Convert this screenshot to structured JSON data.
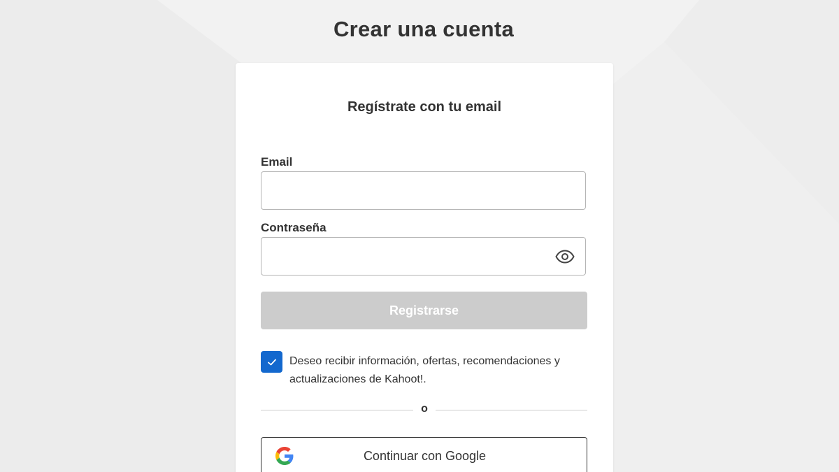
{
  "page": {
    "title": "Crear una cuenta"
  },
  "card": {
    "subtitle": "Regístrate con tu email"
  },
  "email_field": {
    "label": "Email",
    "value": "",
    "placeholder": ""
  },
  "password_field": {
    "label": "Contraseña",
    "value": "",
    "placeholder": "",
    "toggle_icon": "eye-icon"
  },
  "submit": {
    "label": "Registrarse",
    "state": "disabled"
  },
  "consent": {
    "checked": true,
    "text": "Deseo recibir información, ofertas, recomendaciones y actualizaciones de Kahoot!."
  },
  "divider": {
    "text": "o"
  },
  "google_button": {
    "label": "Continuar con Google",
    "icon": "google-icon"
  },
  "colors": {
    "background": "#ececec",
    "card": "#ffffff",
    "text": "#333333",
    "checkbox_accent": "#1368ce",
    "disabled_button": "#cccccc"
  }
}
